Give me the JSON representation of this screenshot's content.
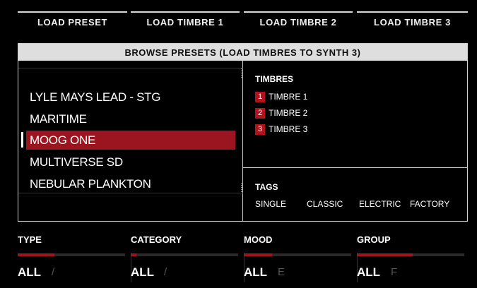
{
  "tabs": [
    "LOAD PRESET",
    "LOAD TIMBRE 1",
    "LOAD TIMBRE 2",
    "LOAD TIMBRE 3"
  ],
  "browser": {
    "title": "BROWSE PRESETS (LOAD TIMBRES TO SYNTH 3)",
    "presets": [
      "LYLE MAYS LEAD - STG",
      "MARITIME",
      "MOOG ONE",
      "MULTIVERSE SD",
      "NEBULAR PLANKTON"
    ],
    "selected_preset": "MOOG ONE",
    "timbres_title": "TIMBRES",
    "timbres": [
      {
        "num": "1",
        "label": "TIMBRE 1"
      },
      {
        "num": "2",
        "label": "TIMBRE 2"
      },
      {
        "num": "3",
        "label": "TIMBRE 3"
      }
    ],
    "tags_title": "TAGS",
    "tags": [
      "SINGLE",
      "CLASSIC",
      "ELECTRIC",
      "FACTORY"
    ]
  },
  "filters": [
    {
      "label": "TYPE",
      "value": "ALL",
      "ghost": "/",
      "fill": 0.34
    },
    {
      "label": "CATEGORY",
      "value": "ALL",
      "ghost": "/",
      "fill": 0.05
    },
    {
      "label": "MOOD",
      "value": "ALL",
      "ghost": "E",
      "fill": 0.26
    },
    {
      "label": "GROUP",
      "value": "ALL",
      "ghost": "F",
      "fill": 0.52
    }
  ],
  "colors": {
    "accent": "#a1141f",
    "panel_header": "#dedede",
    "background": "#000000"
  }
}
